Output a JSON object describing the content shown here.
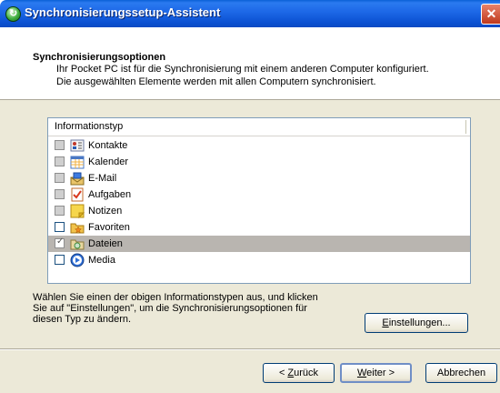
{
  "window": {
    "title": "Synchronisierungssetup-Assistent",
    "close_glyph": "✕"
  },
  "header": {
    "title": "Synchronisierungsoptionen",
    "line1": "Ihr Pocket PC ist für die Synchronisierung mit einem anderen Computer konfiguriert.",
    "line2": "Die ausgewählten Elemente werden mit allen Computern synchronisiert."
  },
  "list": {
    "column_header": "Informationstyp",
    "items": [
      {
        "label": "Kontakte",
        "state": "grayed",
        "icon": "contacts-icon"
      },
      {
        "label": "Kalender",
        "state": "grayed",
        "icon": "calendar-icon"
      },
      {
        "label": "E-Mail",
        "state": "grayed",
        "icon": "email-icon"
      },
      {
        "label": "Aufgaben",
        "state": "grayed",
        "icon": "tasks-icon"
      },
      {
        "label": "Notizen",
        "state": "grayed",
        "icon": "notes-icon"
      },
      {
        "label": "Favoriten",
        "state": "unchecked",
        "icon": "favorites-icon"
      },
      {
        "label": "Dateien",
        "state": "checked",
        "selected": true,
        "icon": "files-icon"
      },
      {
        "label": "Media",
        "state": "unchecked",
        "icon": "media-icon"
      }
    ]
  },
  "description": {
    "line1": "Wählen Sie einen der obigen Informationstypen aus, und klicken",
    "line2": "Sie auf \"Einstellungen\", um die Synchronisierungsoptionen für",
    "line3": "diesen Typ zu ändern."
  },
  "buttons": {
    "settings_mnemonic": "E",
    "settings_rest": "instellungen...",
    "back_prefix": "< ",
    "back_mnemonic": "Z",
    "back_rest": "urück",
    "next_mnemonic": "W",
    "next_rest": "eiter >",
    "cancel": "Abbrechen"
  },
  "colors": {
    "titlebar": "#0a4fd0",
    "dialog_face": "#ece9d8",
    "selection": "#b9b5b0"
  }
}
